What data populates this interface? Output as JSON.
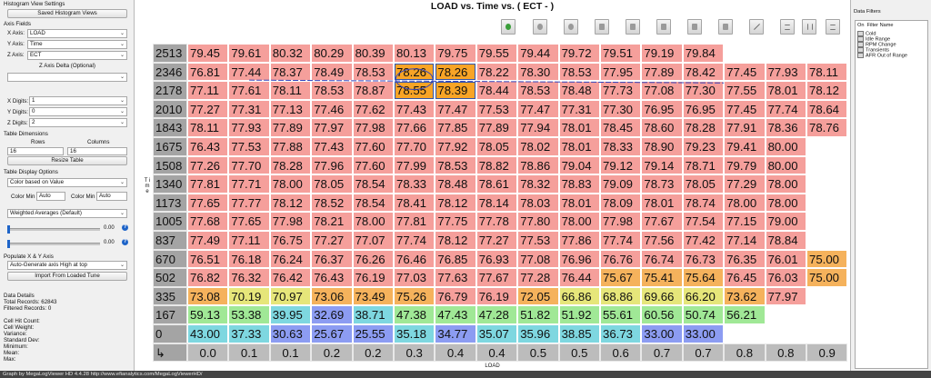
{
  "sidebar": {
    "title": "Histogram View Settings",
    "saved_button": "Saved Histogram Views",
    "axis_fields_header": "Axis Fields",
    "x_axis_label": "X Axis:",
    "x_axis_value": "LOAD",
    "y_axis_label": "Y Axis:",
    "y_axis_value": "Time",
    "z_axis_label": "Z Axis:",
    "z_axis_value": "ECT",
    "z_delta_label": "Z Axis Delta (Optional)",
    "z_delta_value": "",
    "x_digits_label": "X Digits:",
    "x_digits_value": "1",
    "y_digits_label": "Y Digits:",
    "y_digits_value": "0",
    "z_digits_label": "Z Digits:",
    "z_digits_value": "2",
    "table_dims_header": "Table Dimensions",
    "rows_label": "Rows",
    "columns_label": "Columns",
    "rows_value": "16",
    "columns_value": "16",
    "resize_button": "Resize Table",
    "display_options_header": "Table Display Options",
    "color_mode_value": "Color based on Value",
    "color_min_label": "Color Min",
    "color_min_value": "Auto",
    "color_max_label": "Color Min",
    "color_max_value": "Auto",
    "weighting_value": "Weighted Averages (Default)",
    "slider1_value": "0.00",
    "slider2_value": "0.00",
    "populate_header": "Populate X & Y Axis",
    "populate_value": "Auto-Generate axis High at top",
    "import_button": "Import From Loaded Tune",
    "data_details_header": "Data Details",
    "total_records": "Total Records: 62843",
    "filtered_records": "Filtered Records: 0",
    "cell_hit_count": "Cell Hit Count:",
    "cell_weight": "Cell Weight:",
    "variance": "Variance:",
    "std_dev": "Standard Dev:",
    "minimum": "Minimum:",
    "mean": "Mean:",
    "max": "Max:"
  },
  "main": {
    "title": "LOAD vs. Time vs. ( ECT -  )",
    "y_axis_label": "T i m e",
    "x_axis_label": "LOAD",
    "corner_symbol": "↳"
  },
  "table": {
    "row_headers": [
      "2513",
      "2346",
      "2178",
      "2010",
      "1843",
      "1675",
      "1508",
      "1340",
      "1173",
      "1005",
      "837",
      "670",
      "502",
      "335",
      "167",
      "0"
    ],
    "col_headers": [
      "0.0",
      "0.1",
      "0.1",
      "0.2",
      "0.2",
      "0.3",
      "0.4",
      "0.4",
      "0.5",
      "0.5",
      "0.6",
      "0.7",
      "0.7",
      "0.8",
      "0.8",
      "0.9"
    ],
    "rows": [
      [
        "79.45",
        "79.61",
        "80.32",
        "80.29",
        "80.39",
        "80.13",
        "79.75",
        "79.55",
        "79.44",
        "79.72",
        "79.51",
        "79.19",
        "79.84",
        "",
        "",
        ""
      ],
      [
        "76.81",
        "77.44",
        "78.37",
        "78.49",
        "78.53",
        "78.26",
        "78.26",
        "78.22",
        "78.30",
        "78.53",
        "77.95",
        "77.89",
        "78.42",
        "77.45",
        "77.93",
        "78.11"
      ],
      [
        "77.11",
        "77.61",
        "78.11",
        "78.53",
        "78.87",
        "78.55",
        "78.39",
        "78.44",
        "78.53",
        "78.48",
        "77.73",
        "77.08",
        "77.30",
        "77.55",
        "78.01",
        "78.12"
      ],
      [
        "77.27",
        "77.31",
        "77.13",
        "77.46",
        "77.62",
        "77.43",
        "77.47",
        "77.53",
        "77.47",
        "77.31",
        "77.30",
        "76.95",
        "76.95",
        "77.45",
        "77.74",
        "78.64"
      ],
      [
        "78.11",
        "77.93",
        "77.89",
        "77.97",
        "77.98",
        "77.66",
        "77.85",
        "77.89",
        "77.94",
        "78.01",
        "78.45",
        "78.60",
        "78.28",
        "77.91",
        "78.36",
        "78.76"
      ],
      [
        "76.43",
        "77.53",
        "77.88",
        "77.43",
        "77.60",
        "77.70",
        "77.92",
        "78.05",
        "78.02",
        "78.01",
        "78.33",
        "78.90",
        "79.23",
        "79.41",
        "80.00",
        ""
      ],
      [
        "77.26",
        "77.70",
        "78.28",
        "77.96",
        "77.60",
        "77.99",
        "78.53",
        "78.82",
        "78.86",
        "79.04",
        "79.12",
        "79.14",
        "78.71",
        "79.79",
        "80.00",
        ""
      ],
      [
        "77.81",
        "77.71",
        "78.00",
        "78.05",
        "78.54",
        "78.33",
        "78.48",
        "78.61",
        "78.32",
        "78.83",
        "79.09",
        "78.73",
        "78.05",
        "77.29",
        "78.00",
        ""
      ],
      [
        "77.65",
        "77.77",
        "78.12",
        "78.52",
        "78.54",
        "78.41",
        "78.12",
        "78.14",
        "78.03",
        "78.01",
        "78.09",
        "78.01",
        "78.74",
        "78.00",
        "78.00",
        ""
      ],
      [
        "77.68",
        "77.65",
        "77.98",
        "78.21",
        "78.00",
        "77.81",
        "77.75",
        "77.78",
        "77.80",
        "78.00",
        "77.98",
        "77.67",
        "77.54",
        "77.15",
        "79.00",
        ""
      ],
      [
        "77.49",
        "77.11",
        "76.75",
        "77.27",
        "77.07",
        "77.74",
        "78.12",
        "77.27",
        "77.53",
        "77.86",
        "77.74",
        "77.56",
        "77.42",
        "77.14",
        "78.84",
        ""
      ],
      [
        "76.51",
        "76.18",
        "76.24",
        "76.37",
        "76.26",
        "76.46",
        "76.85",
        "76.93",
        "77.08",
        "76.96",
        "76.76",
        "76.74",
        "76.73",
        "76.35",
        "76.01",
        "75.00"
      ],
      [
        "76.82",
        "76.32",
        "76.42",
        "76.43",
        "76.19",
        "77.03",
        "77.63",
        "77.67",
        "77.28",
        "76.44",
        "75.67",
        "75.41",
        "75.64",
        "76.45",
        "76.03",
        "75.00"
      ],
      [
        "73.08",
        "70.19",
        "70.97",
        "73.06",
        "73.49",
        "75.26",
        "76.79",
        "76.19",
        "72.05",
        "66.86",
        "68.86",
        "69.66",
        "66.20",
        "73.62",
        "77.97",
        ""
      ],
      [
        "59.13",
        "53.38",
        "39.95",
        "32.69",
        "38.71",
        "47.38",
        "47.43",
        "47.28",
        "51.82",
        "51.92",
        "55.61",
        "60.56",
        "50.74",
        "56.21",
        "",
        ""
      ],
      [
        "43.00",
        "37.33",
        "30.63",
        "25.67",
        "25.55",
        "35.18",
        "34.77",
        "35.07",
        "35.96",
        "38.85",
        "36.73",
        "33.00",
        "33.00",
        "",
        "",
        ""
      ]
    ],
    "colors": {
      "red": "#f59f9b",
      "orange": "#f5b25c",
      "highlight": "#f8a426",
      "yellow": "#e6e67a",
      "green": "#a0e896",
      "cyan": "#7ed7e0",
      "blue": "#8c9cf2",
      "grid_bg": "#ffffff",
      "header_bg": "#a4a4a4",
      "axis_bg": "#bcbcbc"
    }
  },
  "right_panel": {
    "title": "Data Filters",
    "col_on": "On",
    "col_name": "Filter Name",
    "filters": [
      "Cold",
      "Idle Range",
      "RPM Change",
      "Transients",
      "AFR Out of Range"
    ]
  },
  "status_bar": "Graph by MegaLogViewer HD 4.4.28 http://www.efianalytics.com/MegaLogViewerHD/"
}
